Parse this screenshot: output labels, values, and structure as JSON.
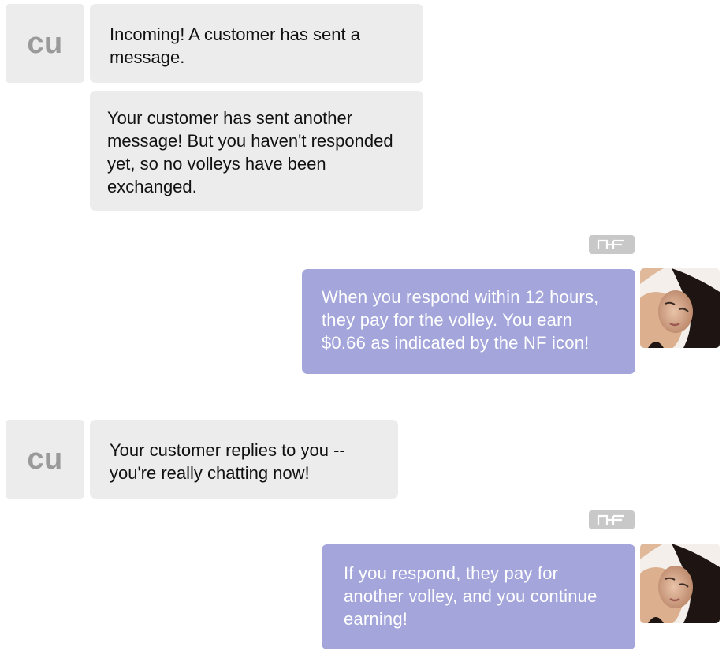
{
  "messages": [
    {
      "sender": "customer",
      "avatar_initials": "cu",
      "text": "Incoming! A customer has sent a message."
    },
    {
      "sender": "customer",
      "text": "Your customer has sent another message! But you haven't responded yet, so no volleys have been exchanged."
    },
    {
      "sender": "you",
      "badge_icon": "nf-logo-icon",
      "avatar": "profile-photo",
      "text": "When you respond within 12 hours, they pay for the volley. You earn $0.66 as indicated by the NF icon!"
    },
    {
      "sender": "customer",
      "avatar_initials": "cu",
      "text": "Your customer replies to you -- you're really chatting now!"
    },
    {
      "sender": "you",
      "badge_icon": "nf-logo-icon",
      "avatar": "profile-photo",
      "text": "If you respond, they pay for another volley, and you continue earning!"
    }
  ],
  "colors": {
    "incoming_bubble": "#ececec",
    "outgoing_bubble": "#a3a5db",
    "avatar_placeholder": "#ececec",
    "avatar_text": "#9a9a9a",
    "nf_badge": "#c8c8c8"
  }
}
